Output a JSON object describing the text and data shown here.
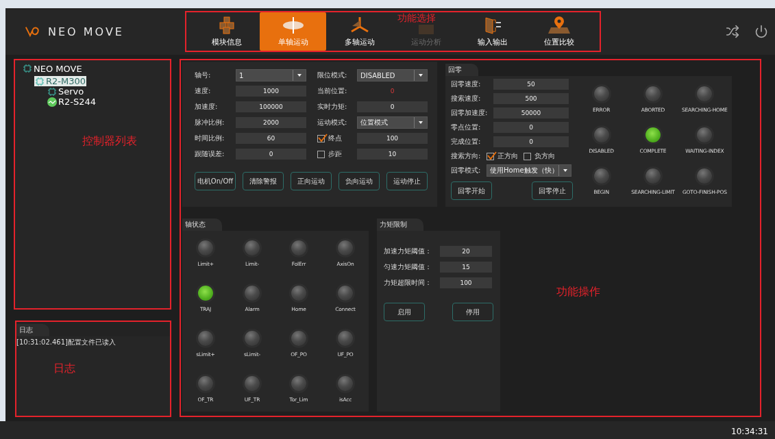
{
  "header": {
    "title": "NEO MOVE",
    "nav": {
      "annotation": "功能选择",
      "tabs": [
        {
          "label": "模块信息",
          "selected": false,
          "disabled": false
        },
        {
          "label": "单轴运动",
          "selected": true,
          "disabled": false
        },
        {
          "label": "多轴运动",
          "selected": false,
          "disabled": false
        },
        {
          "label": "运动分析",
          "selected": false,
          "disabled": true
        },
        {
          "label": "输入输出",
          "selected": false,
          "disabled": false
        },
        {
          "label": "位置比较",
          "selected": false,
          "disabled": false
        }
      ]
    }
  },
  "tree": {
    "annotation": "控制器列表",
    "items": [
      {
        "label": "NEO MOVE",
        "selected": false,
        "children": [
          {
            "label": "R2-M300",
            "selected": true,
            "children": [
              {
                "label": "Servo",
                "selected": false
              },
              {
                "label": "R2-S244",
                "selected": false
              }
            ]
          }
        ]
      }
    ]
  },
  "log": {
    "annotation": "日志",
    "title": "日志",
    "lines": [
      "[10:31:02.461]配置文件已读入"
    ]
  },
  "main": {
    "annotation": "功能操作",
    "axis_form": {
      "columns": [
        [
          {
            "kind": "dropdown",
            "label": "轴号:",
            "value": "1"
          },
          {
            "kind": "field",
            "label": "速度:",
            "value": "1000"
          },
          {
            "kind": "field",
            "label": "加速度:",
            "value": "100000"
          },
          {
            "kind": "field",
            "label": "脉冲比例:",
            "value": "2000"
          },
          {
            "kind": "field",
            "label": "时间比例:",
            "value": "60"
          },
          {
            "kind": "field",
            "label": "跟随误差:",
            "value": "0"
          }
        ],
        [
          {
            "kind": "dropdown",
            "label": "限位模式:",
            "value": "DISABLED"
          },
          {
            "kind": "readout",
            "label": "当前位置:",
            "value": "0"
          },
          {
            "kind": "field",
            "label": "实时力矩:",
            "value": "0"
          },
          {
            "kind": "dropdown",
            "label": "运动模式:",
            "value": "位置模式"
          },
          {
            "kind": "checkbox",
            "label": "终点",
            "checked": true,
            "value": "100"
          },
          {
            "kind": "checkbox",
            "label": "步距",
            "checked": false,
            "value": "10"
          }
        ]
      ],
      "buttons": [
        "电机On/Off",
        "清除警报",
        "正向运动",
        "负向运动",
        "运动停止"
      ]
    },
    "homing": {
      "title": "回零",
      "fields": [
        {
          "label": "回零速度:",
          "value": "50"
        },
        {
          "label": "搜索速度:",
          "value": "500"
        },
        {
          "label": "回零加速度:",
          "value": "50000"
        },
        {
          "label": "零点位置:",
          "value": "0"
        },
        {
          "label": "完成位置:",
          "value": "0"
        }
      ],
      "direction": {
        "label": "搜索方向:",
        "options": [
          {
            "label": "正方向",
            "checked": true
          },
          {
            "label": "负方向",
            "checked": false
          }
        ]
      },
      "mode": {
        "label": "回零模式:",
        "value": "使用Home触发（快）"
      },
      "buttons": [
        "回零开始",
        "回零停止"
      ],
      "lights": [
        {
          "label": "ERROR",
          "on": false
        },
        {
          "label": "ABORTED",
          "on": false
        },
        {
          "label": "SEARCHING-HOME",
          "on": false
        },
        {
          "label": "DISABLED",
          "on": false
        },
        {
          "label": "COMPLETE",
          "on": true
        },
        {
          "label": "WAITING-INDEX",
          "on": false
        },
        {
          "label": "BEGIN",
          "on": false
        },
        {
          "label": "SEARCHING-LIMIT",
          "on": false
        },
        {
          "label": "GOTO-FINISH-POS",
          "on": false
        }
      ]
    },
    "axis_status": {
      "title": "轴状态",
      "lights": [
        {
          "label": "Limit+",
          "on": false
        },
        {
          "label": "Limit-",
          "on": false
        },
        {
          "label": "FolErr",
          "on": false
        },
        {
          "label": "AxisOn",
          "on": false
        },
        {
          "label": "TRAJ",
          "on": true
        },
        {
          "label": "Alarm",
          "on": false
        },
        {
          "label": "Home",
          "on": false
        },
        {
          "label": "Connect",
          "on": false
        },
        {
          "label": "sLimit+",
          "on": false
        },
        {
          "label": "sLimit-",
          "on": false
        },
        {
          "label": "OF_PO",
          "on": false
        },
        {
          "label": "UF_PO",
          "on": false
        },
        {
          "label": "OF_TR",
          "on": false
        },
        {
          "label": "UF_TR",
          "on": false
        },
        {
          "label": "Tor_Lim",
          "on": false
        },
        {
          "label": "isAcc",
          "on": false
        }
      ]
    },
    "torque": {
      "title": "力矩限制",
      "fields": [
        {
          "label": "加速力矩阈值：",
          "value": "20"
        },
        {
          "label": "匀速力矩阈值：",
          "value": "15"
        },
        {
          "label": "力矩超限时间：",
          "value": "100"
        }
      ],
      "buttons": [
        "启用",
        "停用"
      ]
    }
  },
  "status_bar": {
    "time": "10:34:31"
  }
}
